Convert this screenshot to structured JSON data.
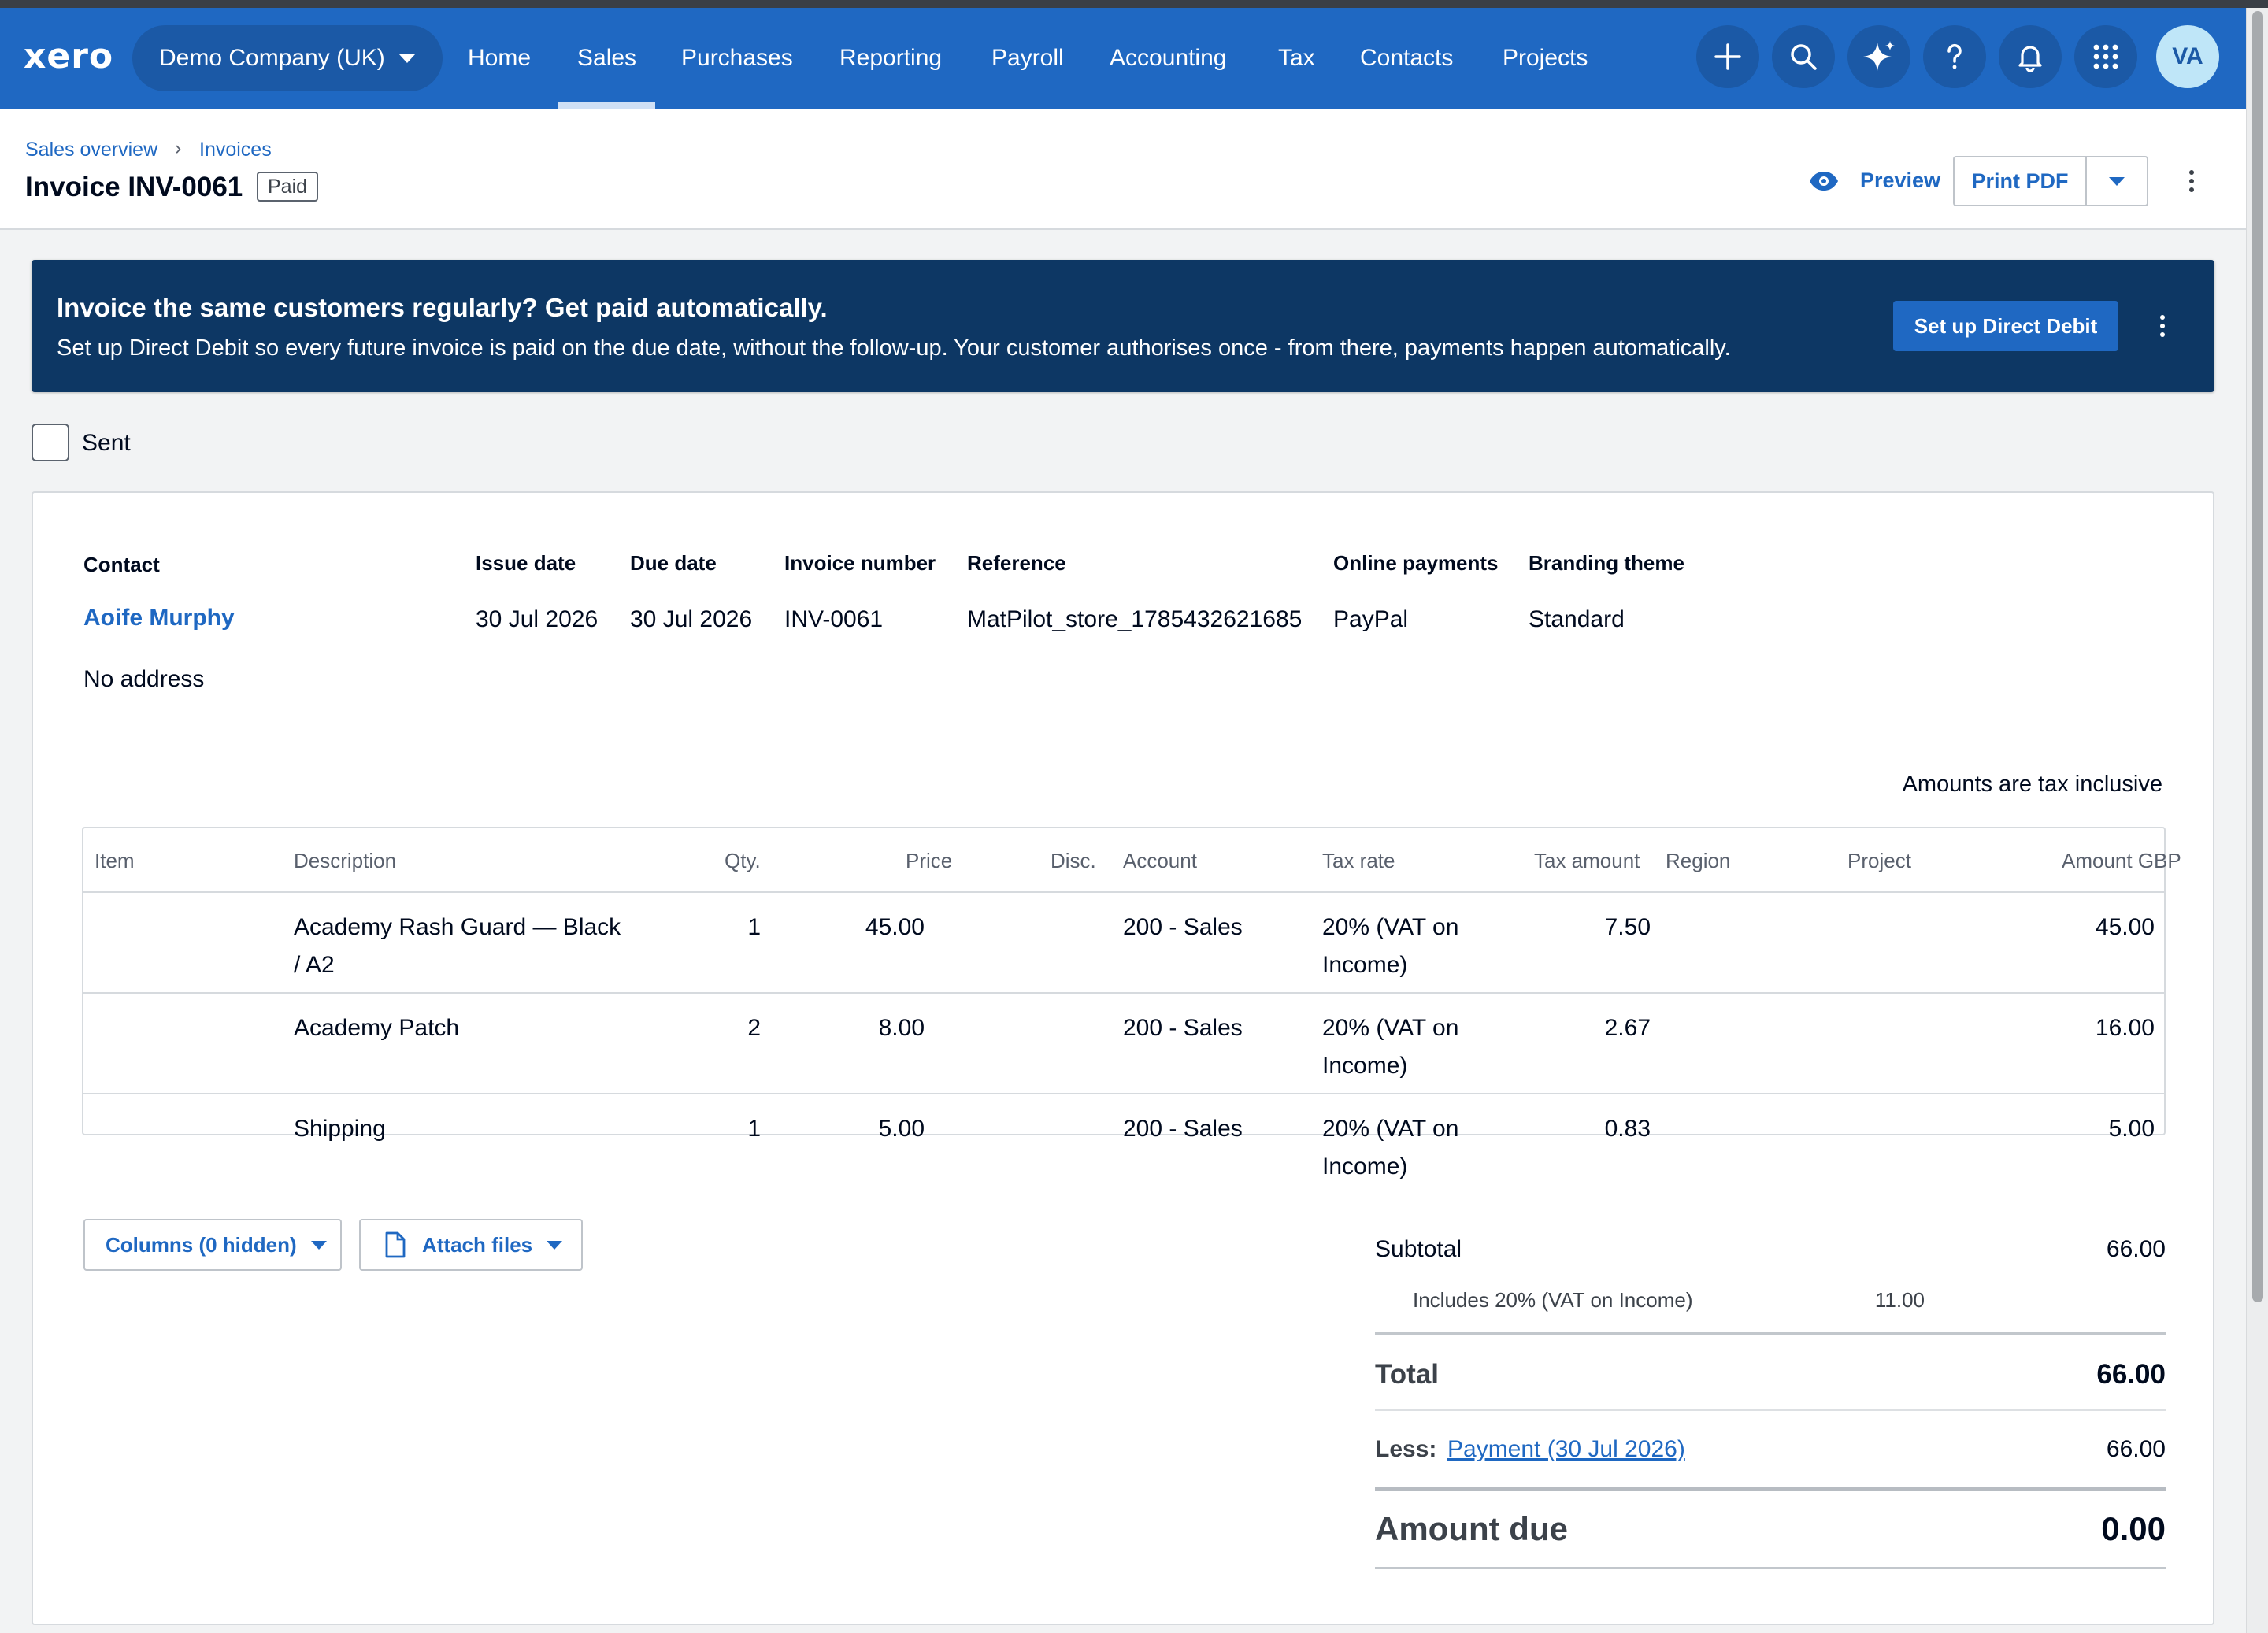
{
  "nav": {
    "logo": "xero",
    "org": "Demo Company (UK)",
    "links": [
      "Home",
      "Sales",
      "Purchases",
      "Reporting",
      "Payroll",
      "Accounting",
      "Tax",
      "Contacts",
      "Projects"
    ],
    "active": "Sales",
    "icons": [
      "plus-icon",
      "search-icon",
      "sparkle-icon",
      "help-icon",
      "bell-icon",
      "apps-grid-icon"
    ],
    "avatar": "VA"
  },
  "header": {
    "breadcrumb": [
      "Sales overview",
      "Invoices"
    ],
    "title": "Invoice INV-0061",
    "status": "Paid",
    "preview": "Preview",
    "print_pdf": "Print PDF"
  },
  "banner": {
    "heading": "Invoice the same customers regularly? Get paid automatically.",
    "text": "Set up Direct Debit so every future invoice is paid on the due date, without the follow-up. Your customer authorises once - from there, payments happen automatically.",
    "button": "Set up Direct Debit"
  },
  "sent": {
    "label": "Sent",
    "checked": false
  },
  "invoice": {
    "labels": {
      "contact": "Contact",
      "issue_date": "Issue date",
      "due_date": "Due date",
      "invoice_number": "Invoice number",
      "reference": "Reference",
      "online_payments": "Online payments",
      "branding_theme": "Branding theme"
    },
    "contact": "Aoife Murphy",
    "address": "No address",
    "issue_date": "30 Jul 2026",
    "due_date": "30 Jul 2026",
    "invoice_number": "INV-0061",
    "reference": "MatPilot_store_1785432621685",
    "online_payments": "PayPal",
    "branding_theme": "Standard",
    "tax_mode": "Amounts are tax inclusive"
  },
  "table": {
    "headers": [
      "Item",
      "Description",
      "Qty.",
      "Price",
      "Disc.",
      "Account",
      "Tax rate",
      "Tax amount",
      "Region",
      "Project",
      "Amount GBP"
    ],
    "rows": [
      {
        "item": "",
        "description_1": "Academy Rash Guard — Black",
        "description_2": "/ A2",
        "qty": "1",
        "price": "45.00",
        "disc": "",
        "account": "200 - Sales",
        "tax_rate_1": "20% (VAT on",
        "tax_rate_2": "Income)",
        "tax_amount": "7.50",
        "region": "",
        "project": "",
        "amount": "45.00"
      },
      {
        "item": "",
        "description_1": "Academy Patch",
        "description_2": "",
        "qty": "2",
        "price": "8.00",
        "disc": "",
        "account": "200 - Sales",
        "tax_rate_1": "20% (VAT on",
        "tax_rate_2": "Income)",
        "tax_amount": "2.67",
        "region": "",
        "project": "",
        "amount": "16.00"
      },
      {
        "item": "",
        "description_1": "Shipping",
        "description_2": "",
        "qty": "1",
        "price": "5.00",
        "disc": "",
        "account": "200 - Sales",
        "tax_rate_1": "20% (VAT on",
        "tax_rate_2": "Income)",
        "tax_amount": "0.83",
        "region": "",
        "project": "",
        "amount": "5.00"
      }
    ]
  },
  "actions": {
    "columns": "Columns (0 hidden)",
    "attach": "Attach files"
  },
  "totals": {
    "subtotal_label": "Subtotal",
    "subtotal": "66.00",
    "includes_label": "Includes 20% (VAT on Income)",
    "includes": "11.00",
    "total_label": "Total",
    "total": "66.00",
    "less_label": "Less:",
    "payment_link": "Payment (30 Jul 2026)",
    "payment": "66.00",
    "amount_due_label": "Amount due",
    "amount_due": "0.00"
  },
  "colors": {
    "nav": "#1f68c2",
    "banner": "#0d3764",
    "link": "#1f68c2"
  }
}
